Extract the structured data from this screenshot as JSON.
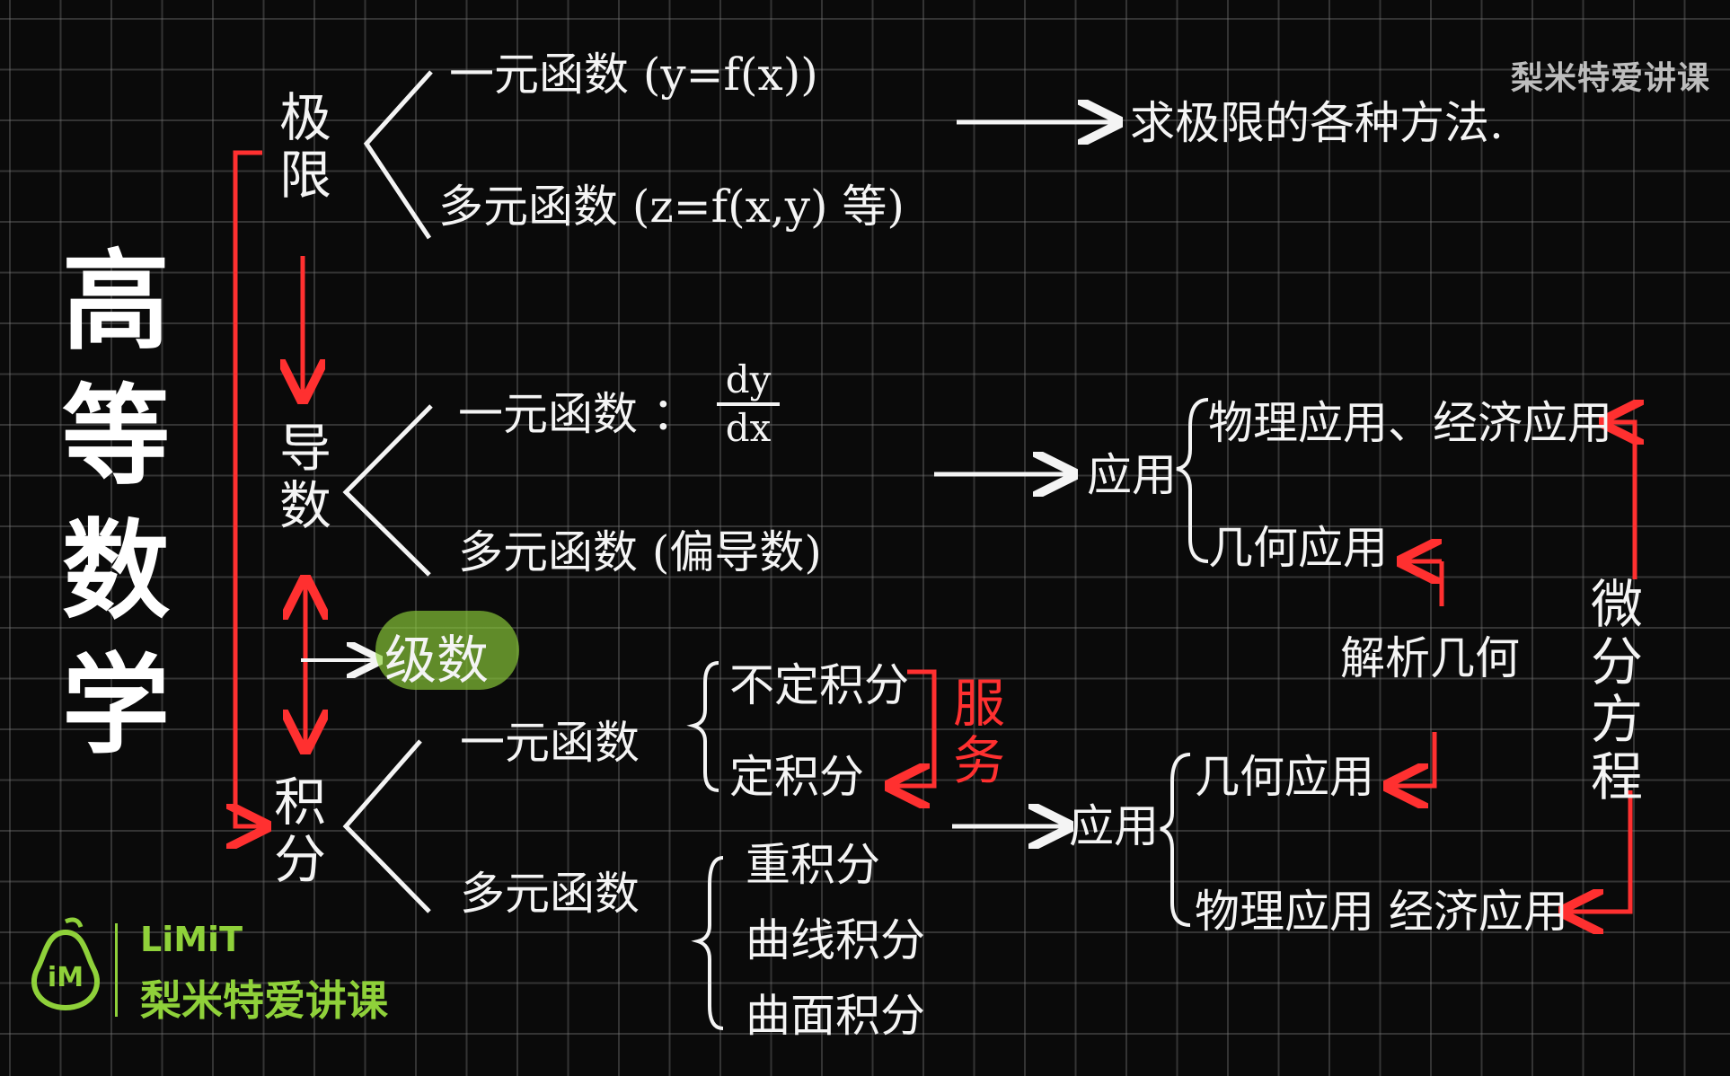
{
  "title": "高等数学",
  "watermark_top": "梨米特爱讲课",
  "logo": {
    "name": "LiMiT",
    "subtitle": "梨米特爱讲课",
    "mark": "iM"
  },
  "branches": {
    "limit": {
      "label": "极限",
      "items": [
        "一元函数 (y=f(x))",
        "多元函数 (z=f(x,y) 等)"
      ],
      "result": "求极限的各种方法."
    },
    "derivative": {
      "label": "导数",
      "items": [
        "一元函数 ：",
        "多元函数 (偏导数)"
      ],
      "fraction": {
        "num": "dy",
        "den": "dx"
      },
      "app_label": "应用",
      "apps": [
        "物理应用、经济应用",
        "几何应用"
      ]
    },
    "series": {
      "label": "级数"
    },
    "integral": {
      "label": "积分",
      "single": {
        "label": "一元函数",
        "items": [
          "不定积分",
          "定积分"
        ]
      },
      "serve": "服务",
      "multi": {
        "label": "多元函数",
        "items": [
          "重积分",
          "曲线积分",
          "曲面积分"
        ]
      },
      "app_label": "应用",
      "apps": [
        "几何应用",
        "物理应用 经济应用"
      ]
    },
    "analytic_geometry": "解析几何",
    "diff_eq": "微分方程"
  },
  "colors": {
    "chalk": "#f4f4f4",
    "red": "#ff3030",
    "brand_green": "#8fd13a",
    "background": "#0a0a0a"
  }
}
